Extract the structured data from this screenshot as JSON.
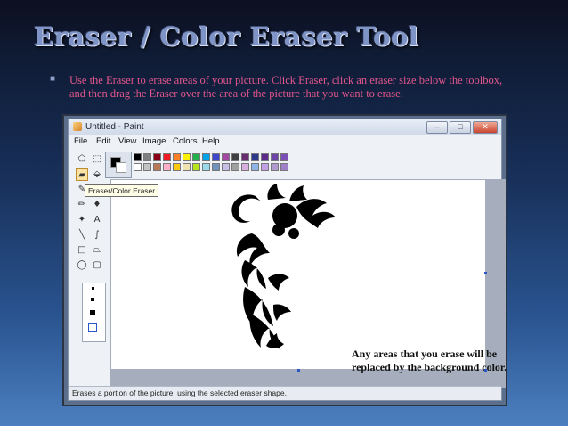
{
  "slide": {
    "title": "Eraser / Color Eraser Tool",
    "bullet_text": "Use the Eraser to erase areas of your picture. Click Eraser, click an eraser size below the toolbox, and then drag the Eraser over the area of the picture that you want to erase."
  },
  "window": {
    "title": "Untitled - Paint",
    "minimize_icon": "minimize-icon",
    "maximize_icon": "maximize-icon",
    "close_icon": "close-icon"
  },
  "menu": [
    "File",
    "Edit",
    "View",
    "Image",
    "Colors",
    "Help"
  ],
  "toolbox": {
    "tools": [
      {
        "name": "free-select-icon",
        "glyph": "⬠"
      },
      {
        "name": "rect-select-icon",
        "glyph": "⬚"
      },
      {
        "name": "eraser-icon",
        "glyph": "▰",
        "selected": true
      },
      {
        "name": "fill-icon",
        "glyph": "⬙"
      },
      {
        "name": "picker-icon",
        "glyph": "✎"
      },
      {
        "name": "magnifier-icon",
        "glyph": "⌕"
      },
      {
        "name": "pencil-icon",
        "glyph": "✏"
      },
      {
        "name": "brush-icon",
        "glyph": "♦"
      },
      {
        "name": "airbrush-icon",
        "glyph": "✦"
      },
      {
        "name": "text-icon",
        "glyph": "A"
      },
      {
        "name": "line-icon",
        "glyph": "╲"
      },
      {
        "name": "curve-icon",
        "glyph": "∫"
      },
      {
        "name": "rectangle-icon",
        "glyph": "□"
      },
      {
        "name": "polygon-icon",
        "glyph": "⏢"
      },
      {
        "name": "ellipse-icon",
        "glyph": "◯"
      },
      {
        "name": "rounded-rect-icon",
        "glyph": "▢"
      }
    ],
    "tooltip": "Eraser/Color Eraser"
  },
  "palette": {
    "row1": [
      "#000000",
      "#7f7f7f",
      "#880015",
      "#ed1c24",
      "#ff7f27",
      "#fff200",
      "#22b14c",
      "#00a2e8",
      "#3f48cc",
      "#a349a4",
      "#404040",
      "#6a2c70",
      "#2d3a8c",
      "#5a2b8a",
      "#6b46a8",
      "#7b4fb6"
    ],
    "row2": [
      "#ffffff",
      "#c3c3c3",
      "#b97a57",
      "#ffaec9",
      "#ffc90e",
      "#efe4b0",
      "#b5e61d",
      "#99d9ea",
      "#7092be",
      "#c8bfe7",
      "#a0a0a0",
      "#d7aee0",
      "#8fb4e8",
      "#c3a0e6",
      "#b09ad0",
      "#9f7fc8"
    ]
  },
  "canvas": {
    "annotation": "Any areas that you erase will be replaced by the background color."
  },
  "statusbar": {
    "text": "Erases a portion of the picture, using the selected eraser shape."
  }
}
